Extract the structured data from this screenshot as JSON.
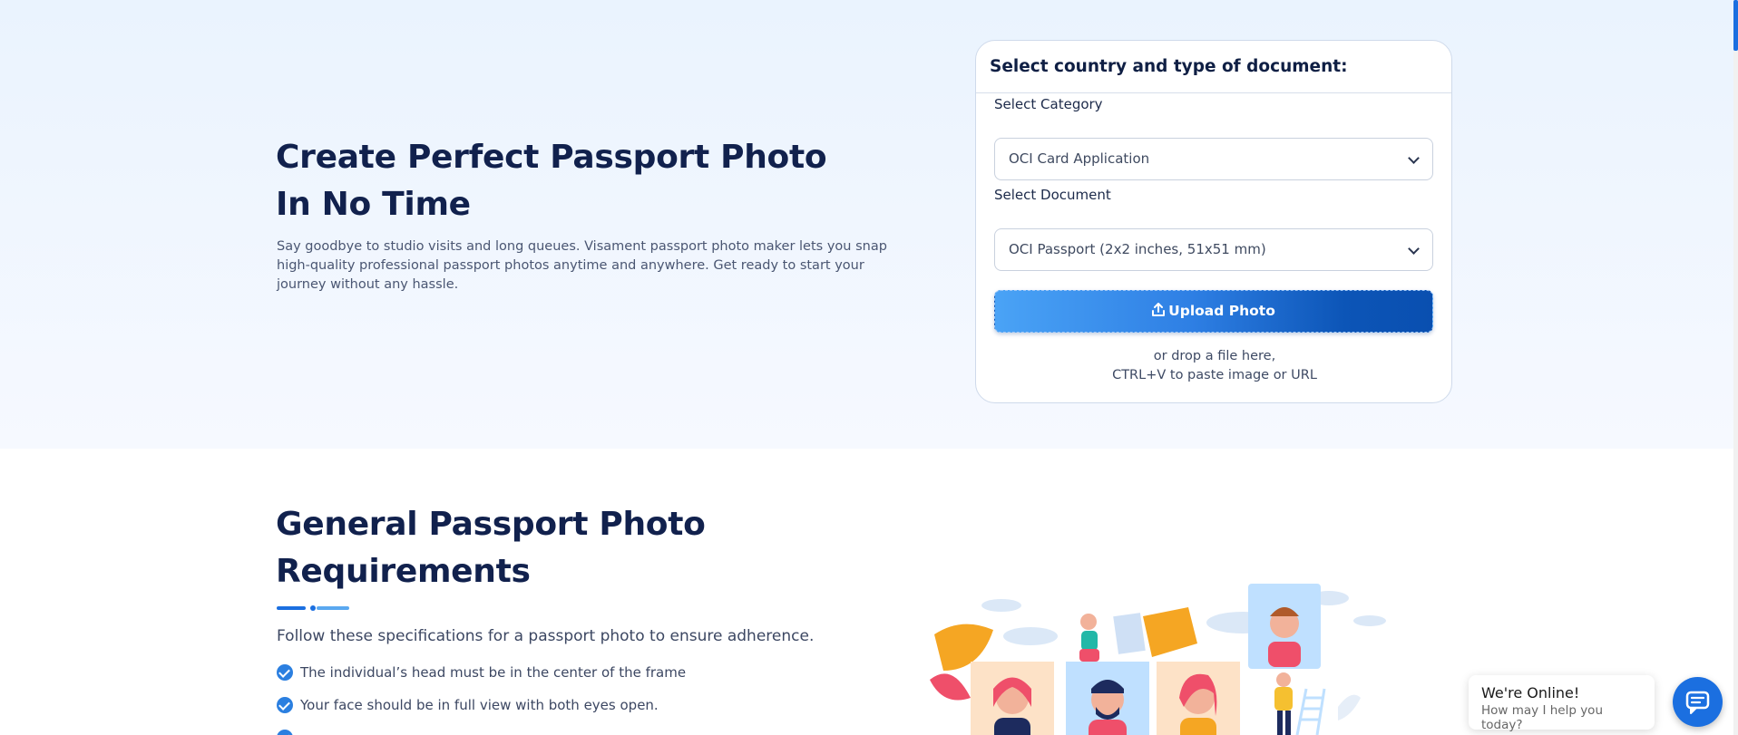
{
  "hero": {
    "title_line1": "Create Perfect Passport Photo",
    "title_line2": "In No Time",
    "description": "Say goodbye to studio visits and long queues. Visament passport photo maker lets you snap high-quality professional passport photos anytime and anywhere. Get ready to start your journey without any hassle."
  },
  "card": {
    "heading": "Select country and type of document:",
    "category_label": "Select Category",
    "category_value": "OCI Card Application",
    "document_label": "Select Document",
    "document_value": "OCI Passport (2x2 inches, 51x51 mm)",
    "upload_label": "Upload Photo",
    "drop_line1": "or drop a file here,",
    "drop_line2": "CTRL+V to paste image or URL"
  },
  "requirements": {
    "title_line1": "General Passport Photo",
    "title_line2": "Requirements",
    "subtitle": "Follow these specifications for a passport photo to ensure adherence.",
    "items": [
      "The individual’s head must be in the center of the frame",
      "Your face should be in full view with both eyes open."
    ]
  },
  "chat": {
    "title": "We're Online!",
    "subtitle": "How may I help you today?"
  },
  "colors": {
    "accent": "#1b6fe0",
    "heading": "#11214d",
    "hero_bg": "#eaf3fe"
  },
  "icons": [
    "upload-icon",
    "chevron-down-icon",
    "check-icon",
    "chat-icon"
  ]
}
